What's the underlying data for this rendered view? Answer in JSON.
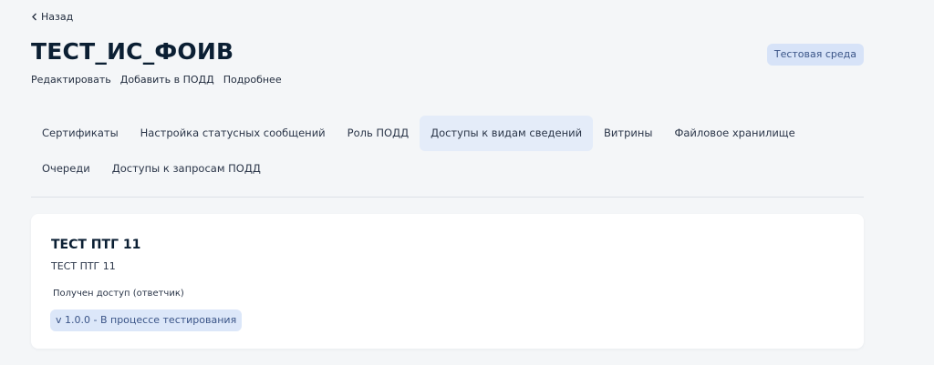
{
  "nav": {
    "back_label": "Назад"
  },
  "header": {
    "title": "ТЕСТ_ИС_ФОИВ",
    "env_badge": "Тестовая среда",
    "actions": [
      "Редактировать",
      "Добавить в ПОДД",
      "Подробнее"
    ]
  },
  "tabs": [
    {
      "label": "Сертификаты",
      "active": false
    },
    {
      "label": "Настройка статусных сообщений",
      "active": false
    },
    {
      "label": "Роль ПОДД",
      "active": false
    },
    {
      "label": "Доступы к видам сведений",
      "active": true
    },
    {
      "label": "Витрины",
      "active": false
    },
    {
      "label": "Файловое хранилище",
      "active": false
    },
    {
      "label": "Очереди",
      "active": false
    },
    {
      "label": "Доступы к запросам ПОДД",
      "active": false
    }
  ],
  "card": {
    "title": "ТЕСТ ПТГ 11",
    "subtitle": "ТЕСТ ПТГ 11",
    "access_label": "Получен доступ (ответчик)",
    "version_badge": "v 1.0.0 - В процессе тестирования"
  },
  "colors": {
    "page_bg": "#f4f6f8",
    "badge_bg": "#d7e3f8",
    "badge_text": "#3a5487",
    "active_tab_bg": "#e4ecf9"
  }
}
